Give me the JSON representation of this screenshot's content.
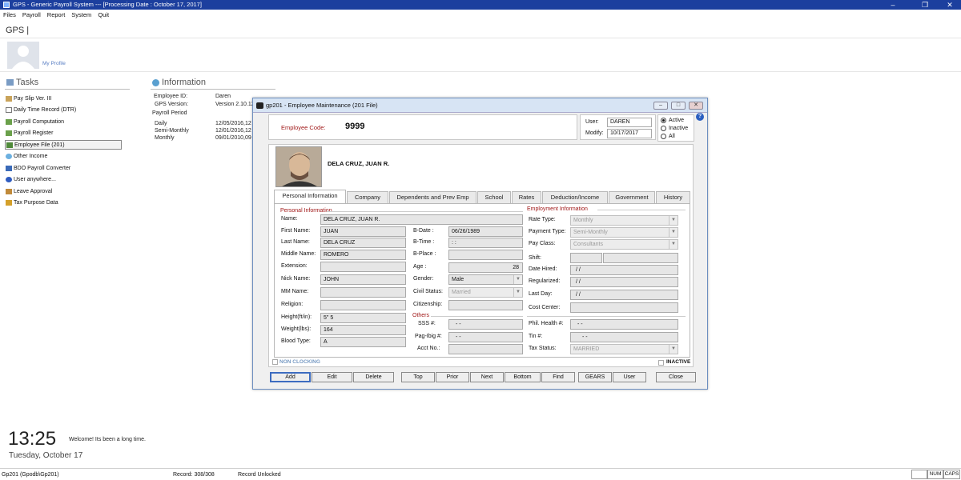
{
  "window": {
    "title": "GPS - Generic Payroll System --- [Processing Date : October 17, 2017]",
    "minimize": "–",
    "maximize": "❐",
    "close": "✕"
  },
  "menu": [
    "Files",
    "Payroll",
    "Report",
    "System",
    "Quit"
  ],
  "header": {
    "app_short": "GPS |",
    "my_profile": "My Profile"
  },
  "tasks": {
    "title": "Tasks",
    "items": [
      {
        "label": "Pay Slip Ver. III",
        "icon": "payslip-icon"
      },
      {
        "label": "Daily Time Record (DTR)",
        "icon": "document-icon"
      },
      {
        "label": "Payroll Computation",
        "icon": "payroll-icon"
      },
      {
        "label": "Payroll Register",
        "icon": "register-icon"
      },
      {
        "label": "Employee File (201)",
        "icon": "employee-file-icon"
      },
      {
        "label": "Other Income",
        "icon": "globe-icon"
      },
      {
        "label": "BDO Payroll Converter",
        "icon": "converter-icon"
      },
      {
        "label": "User anywhere...",
        "icon": "user-icon"
      },
      {
        "label": "Leave  Approval",
        "icon": "leave-icon"
      },
      {
        "label": "Tax Purpose Data",
        "icon": "tax-icon"
      }
    ]
  },
  "information": {
    "title": "Information",
    "employee_id_label": "Employee ID:",
    "employee_id": "Daren",
    "gps_version_label": "GPS Version:",
    "gps_version": "Version 2.10.12",
    "payroll_period_label": "Payroll Period",
    "periods": [
      {
        "label": "Daily",
        "value": "12/05/2016,12"
      },
      {
        "label": "Semi-Monthly",
        "value": "12/01/2016,12"
      },
      {
        "label": "Monthly",
        "value": "09/01/2010,09"
      }
    ]
  },
  "dialog": {
    "title": "gp201 - Employee Maintenance (201 File)",
    "help": "?",
    "employee_code_label": "Employee Code:",
    "employee_code": "9999",
    "user_label": "User:",
    "user": "DAREN",
    "modify_label": "Modify:",
    "modify": "10/17/2017",
    "status_options": [
      "Active",
      "Inactive",
      "All"
    ],
    "status_selected": "Active",
    "employee_name": "DELA CRUZ, JUAN R.",
    "tabs": [
      "Personal Information",
      "Company",
      "Dependents and Prev Emp",
      "School",
      "Rates",
      "Deduction/Income",
      "Government",
      "History"
    ],
    "active_tab": "Personal Information",
    "personal": {
      "section": "Personal Information",
      "name_label": "Name:",
      "name": "DELA CRUZ, JUAN R.",
      "first_name_label": "First Name:",
      "first_name": "JUAN",
      "last_name_label": "Last Name:",
      "last_name": "DELA CRUZ",
      "middle_name_label": "Middle Name:",
      "middle_name": "ROMERO",
      "extension_label": "Extension:",
      "extension": "",
      "nick_name_label": "Nick Name:",
      "nick_name": "JOHN",
      "mm_name_label": "MM Name:",
      "mm_name": "",
      "religion_label": "Religion:",
      "religion": "",
      "height_label": "Height(ft/in):",
      "height": "5\" 5",
      "weight_label": "Weight(lbs):",
      "weight": "164",
      "blood_type_label": "Blood Type:",
      "blood_type": "A",
      "bdate_label": "B-Date :",
      "bdate": "06/26/1989",
      "btime_label": "B-Time :",
      "btime": ": :",
      "bplace_label": "B-Place :",
      "bplace": "",
      "age_label": "Age :",
      "age": "28",
      "gender_label": "Gender:",
      "gender": "Male",
      "civil_status_label": "Civil Status:",
      "civil_status": "Married",
      "citizenship_label": "Citizenship:",
      "citizenship": ""
    },
    "others": {
      "section": "Others",
      "sss_label": "SSS #:",
      "sss": "-     -",
      "pagibig_label": "Pag-Ibig #:",
      "pagibig": "-     -",
      "acct_label": "Acct No.:",
      "acct": ""
    },
    "employment": {
      "section": "Employment Information",
      "rate_type_label": "Rate Type:",
      "rate_type": "Monthly",
      "payment_type_label": "Payment Type:",
      "payment_type": "Semi-Monthly",
      "pay_class_label": "Pay Class:",
      "pay_class": "Consultants",
      "shift_label": "Shift:",
      "shift": "",
      "date_hired_label": "Date Hired:",
      "date_hired": "/ /",
      "regularized_label": "Regularized:",
      "regularized": "/ /",
      "last_day_label": "Last Day:",
      "last_day": "/ /",
      "cost_center_label": "Cost Center:",
      "cost_center": "",
      "phil_health_label": "Phil. Health #:",
      "phil_health": "-     -",
      "tin_label": "Tin #:",
      "tin": "-  -",
      "tax_status_label": "Tax Status:",
      "tax_status": "MARRIED"
    },
    "non_clocking_label": "NON CLOCKING",
    "inactive_label": "INACTIVE",
    "buttons": [
      "Add",
      "Edit",
      "Delete",
      "Top",
      "Prior",
      "Next",
      "Bottom",
      "Find",
      "GEARS",
      "User",
      "Close"
    ]
  },
  "clock": {
    "time": "13:25",
    "welcome": "Welcome! Its been a long time.",
    "date": "Tuesday, October 17"
  },
  "statusbar": {
    "module": "Gp201 (Gpodb\\Gp201)",
    "record": "Record: 308/308",
    "lock": "Record Unlocked",
    "num": "NUM",
    "caps": "CAPS"
  },
  "colors": {
    "titlebar": "#1c3f9e",
    "accent_red": "#a01818",
    "dialog_border": "#6c8ebf"
  }
}
